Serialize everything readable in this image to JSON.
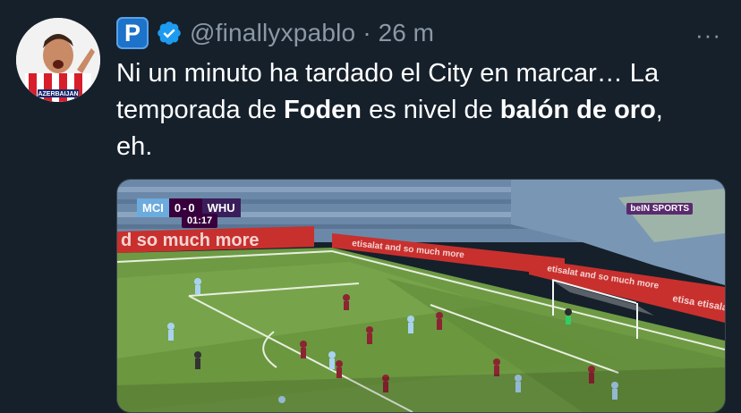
{
  "tweet": {
    "badge_letter": "P",
    "handle": "@finallyxpablo",
    "separator": "·",
    "time": "26 m",
    "more": "···",
    "text_part1": "Ni un minuto ha tardado el City en marcar… La temporada de ",
    "text_bold1": "Foden",
    "text_part2": " es nivel de ",
    "text_bold2": "balón de oro",
    "text_part3": ",\neh.",
    "avatar_text": "AZERBAIJAN"
  },
  "media": {
    "home_team": "MCI",
    "away_team": "WHU",
    "score": "0-0",
    "clock": "01:17",
    "broadcaster": "beIN SPORTS",
    "ad_text_1": "d so much more",
    "ad_text_2": "etisalat and so much more",
    "ad_text_3": "etisalat and so much more",
    "ad_text_4": "etisa etisalat an"
  },
  "colors": {
    "background": "#15202b",
    "text": "#e7e9ea",
    "muted": "#8b98a5",
    "verified": "#1d9bf0",
    "badge": "#1d72c9"
  }
}
